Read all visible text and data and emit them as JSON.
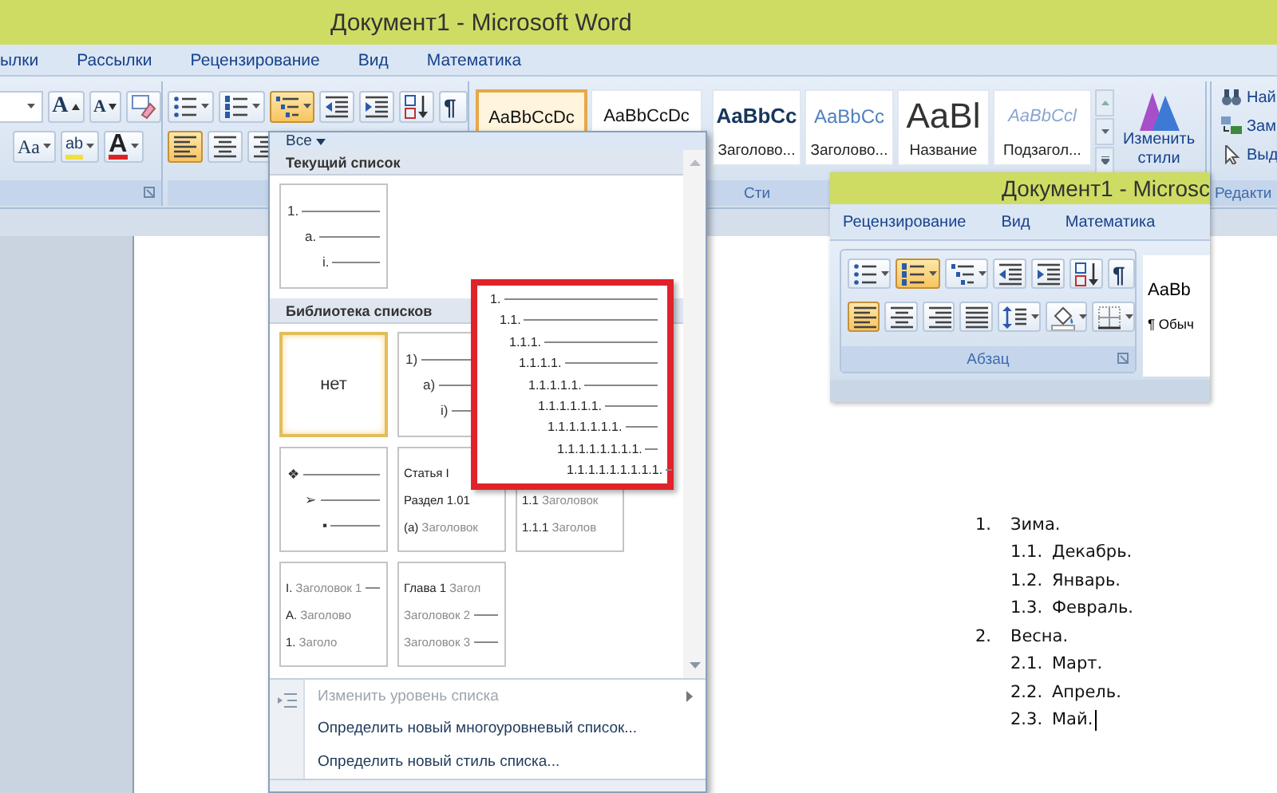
{
  "window": {
    "title": "Документ1 - Microsoft Word"
  },
  "tabs": [
    {
      "label": "ылки",
      "selected": false
    },
    {
      "label": "Рассылки",
      "selected": false
    },
    {
      "label": "Рецензирование",
      "selected": false
    },
    {
      "label": "Вид",
      "selected": false
    },
    {
      "label": "Математика",
      "selected": false
    }
  ],
  "ribbon": {
    "font_group": {
      "row1": [
        {
          "kind": "size-field"
        },
        {
          "kind": "grow-font",
          "label": "A",
          "selected": false
        },
        {
          "kind": "shrink-font",
          "label": "A",
          "selected": false
        },
        {
          "kind": "clear-format",
          "selected": false
        }
      ],
      "row2": [
        {
          "kind": "change-case",
          "label": "Aa",
          "selected": false
        },
        {
          "kind": "highlight",
          "label": "ab",
          "selected": false
        },
        {
          "kind": "font-color",
          "label": "A",
          "selected": false
        }
      ]
    },
    "paragraph_group": {
      "row1": [
        {
          "kind": "bullets",
          "selected": false
        },
        {
          "kind": "numbering",
          "selected": false
        },
        {
          "kind": "multilevel",
          "selected": true
        },
        {
          "kind": "outdent",
          "selected": false
        },
        {
          "kind": "indent",
          "selected": false
        },
        {
          "kind": "sort",
          "selected": false
        },
        {
          "kind": "pilcrow",
          "label": "¶",
          "selected": false
        }
      ],
      "row2": [
        {
          "kind": "align-left",
          "selected": true
        },
        {
          "kind": "align-center",
          "selected": false
        },
        {
          "kind": "align-right",
          "selected": false
        }
      ]
    },
    "styles_group": {
      "label": "Сти",
      "items": [
        {
          "kind": "normal",
          "sample": "AaBbCcDc",
          "selected": true
        },
        {
          "kind": "no-spacing",
          "sample": "AaBbCcDc",
          "selected": false
        },
        {
          "kind": "heading1",
          "sample": "AaBbCc",
          "caption": "Заголово...",
          "selected": false
        },
        {
          "kind": "heading2",
          "sample": "AaBbCc",
          "caption": "Заголово...",
          "selected": false
        },
        {
          "kind": "title",
          "sample": "AaBl",
          "caption": "Название",
          "selected": false
        },
        {
          "kind": "subtitle",
          "sample": "AaBbCcl",
          "caption": "Подзагол...",
          "selected": false
        }
      ],
      "change_styles": {
        "label": "Изменить стили"
      }
    },
    "editing_group": {
      "label": "Редакти",
      "items": [
        {
          "kind": "find",
          "label": "Най"
        },
        {
          "kind": "replace",
          "label": "Зам"
        },
        {
          "kind": "select",
          "label": "Выд"
        }
      ]
    }
  },
  "list_menu": {
    "filter": "Все",
    "sections": [
      {
        "title": "Текущий список",
        "tiles": [
          {
            "kind": "levels",
            "selected": false,
            "lines": [
              "1.",
              "a.",
              "i."
            ]
          }
        ]
      },
      {
        "title": "Библиотека списков",
        "tiles": [
          {
            "kind": "none",
            "label": "нет",
            "selected": true
          },
          {
            "kind": "levels",
            "selected": false,
            "lines": [
              "1)",
              "a)",
              "i)"
            ]
          },
          {
            "kind": "preview",
            "lines": [
              "1.",
              "1.1.",
              "1.1.1.",
              "1.1.1.1.",
              "1.1.1.1.1.",
              "1.1.1.1.1.1.",
              "1.1.1.1.1.1.1.",
              "1.1.1.1.1.1.1.1.",
              "1.1.1.1.1.1.1.1.1."
            ]
          },
          {
            "kind": "levels",
            "selected": false,
            "lines": [
              "❖",
              "➢",
              "▪"
            ]
          },
          {
            "kind": "headings",
            "selected": false,
            "lines": [
              {
                "num": "Статья I"
              },
              {
                "num": "Раздел 1.01"
              },
              {
                "num": "(a)",
                "text": "Заголовок"
              }
            ]
          },
          {
            "kind": "headings",
            "selected": false,
            "lines": [
              {
                "num": "1.1",
                "text": "Заголовок"
              },
              {
                "num": "1.1.1",
                "text": "Заголов"
              }
            ]
          },
          {
            "kind": "headings",
            "selected": false,
            "lines": [
              {
                "num": "I.",
                "text": "Заголовок 1",
                "rule": true
              },
              {
                "num": "A.",
                "text": "Заголово"
              },
              {
                "num": "1.",
                "text": "Заголо"
              }
            ]
          },
          {
            "kind": "headings",
            "selected": false,
            "lines": [
              {
                "num": "Глава 1",
                "text": "Загол"
              },
              {
                "text": "Заголовок 2",
                "rule": true
              },
              {
                "text": "Заголовок 3",
                "rule": true
              }
            ]
          }
        ]
      }
    ],
    "footer": [
      {
        "label": "Изменить уровень списка",
        "disabled": true,
        "submenu": true
      },
      {
        "label": "Определить новый многоуровневый список...",
        "disabled": false,
        "submenu": false
      },
      {
        "label": "Определить новый стиль списка...",
        "disabled": false,
        "submenu": false
      }
    ]
  },
  "inset_window": {
    "title": "Документ1 - Microsc",
    "tabs": [
      {
        "label": "Рецензирование",
        "selected": false
      },
      {
        "label": "Вид",
        "selected": false
      },
      {
        "label": "Математика",
        "selected": false
      }
    ],
    "row1": [
      {
        "kind": "bullets",
        "selected": false
      },
      {
        "kind": "numbering",
        "selected": true
      },
      {
        "kind": "multilevel",
        "selected": false
      },
      {
        "kind": "outdent",
        "selected": false
      },
      {
        "kind": "indent",
        "selected": false
      },
      {
        "kind": "sort",
        "selected": false
      },
      {
        "kind": "pilcrow",
        "label": "¶",
        "selected": false
      }
    ],
    "row2": [
      {
        "kind": "align-left",
        "selected": true
      },
      {
        "kind": "align-center",
        "selected": false
      },
      {
        "kind": "align-right",
        "selected": false
      },
      {
        "kind": "justify",
        "selected": false
      },
      {
        "kind": "line-spacing",
        "selected": false
      },
      {
        "kind": "shading",
        "selected": false
      },
      {
        "kind": "borders",
        "selected": false
      }
    ],
    "group_label": "Абзац",
    "style_sample": "AaBb",
    "style_caption": "¶ Обыч"
  },
  "document": {
    "list": [
      {
        "number": "1.",
        "text": "Зима.",
        "children": [
          {
            "number": "1.1.",
            "text": "Декабрь."
          },
          {
            "number": "1.2.",
            "text": "Январь."
          },
          {
            "number": "1.3.",
            "text": "Февраль."
          }
        ]
      },
      {
        "number": "2.",
        "text": "Весна.",
        "children": [
          {
            "number": "2.1.",
            "text": "Март."
          },
          {
            "number": "2.2.",
            "text": "Апрель."
          },
          {
            "number": "2.3.",
            "text": "Май."
          }
        ]
      }
    ]
  }
}
